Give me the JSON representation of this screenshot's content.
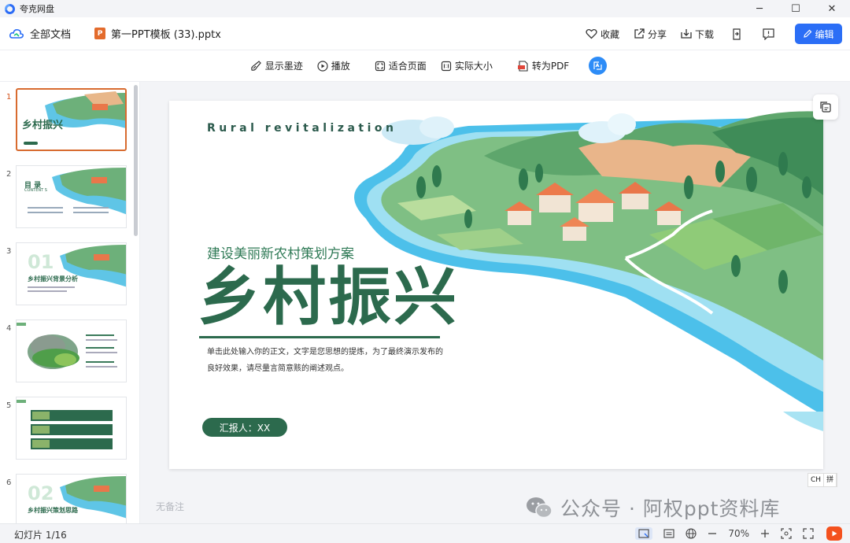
{
  "app": {
    "name": "夸克网盘"
  },
  "window": {
    "minimize": "─",
    "maximize": "☐",
    "close": "✕"
  },
  "docbar": {
    "all_docs": "全部文档",
    "ppt_badge": "P",
    "file_name": "第一PPT模板 (33).pptx",
    "collect": "收藏",
    "share": "分享",
    "download": "下载",
    "edit": "编辑"
  },
  "toolbar": {
    "show_ink": "显示墨迹",
    "play": "播放",
    "fit_page": "适合页面",
    "actual_size": "实际大小",
    "to_pdf": "转为PDF"
  },
  "thumbnails": [
    {
      "num": "1",
      "active": true,
      "title": "乡村振兴"
    },
    {
      "num": "2",
      "active": false,
      "title": "目 录",
      "sub": "CONTENT S"
    },
    {
      "num": "3",
      "active": false,
      "big": "01",
      "title": "乡村振兴背景分析"
    },
    {
      "num": "4",
      "active": false
    },
    {
      "num": "5",
      "active": false
    },
    {
      "num": "6",
      "active": false,
      "big": "02",
      "title": "乡村振兴策划思路"
    }
  ],
  "slide": {
    "en_title": "Rural revitalization",
    "subtitle": "建设美丽新农村策划方案",
    "title": "乡村振兴",
    "body": "单击此处输入你的正文，文字是您思想的提炼，为了最终演示发布的良好效果，请尽量言简意赅的阐述观点。",
    "reporter": "汇报人：XX"
  },
  "notes_placeholder": "无备注",
  "ime": {
    "mode": "CH",
    "pinyin": "拼"
  },
  "watermark": "公众号 · 阿权ppt资料库",
  "status": {
    "slide_count": "幻灯片 1/16",
    "zoom": "70%"
  }
}
